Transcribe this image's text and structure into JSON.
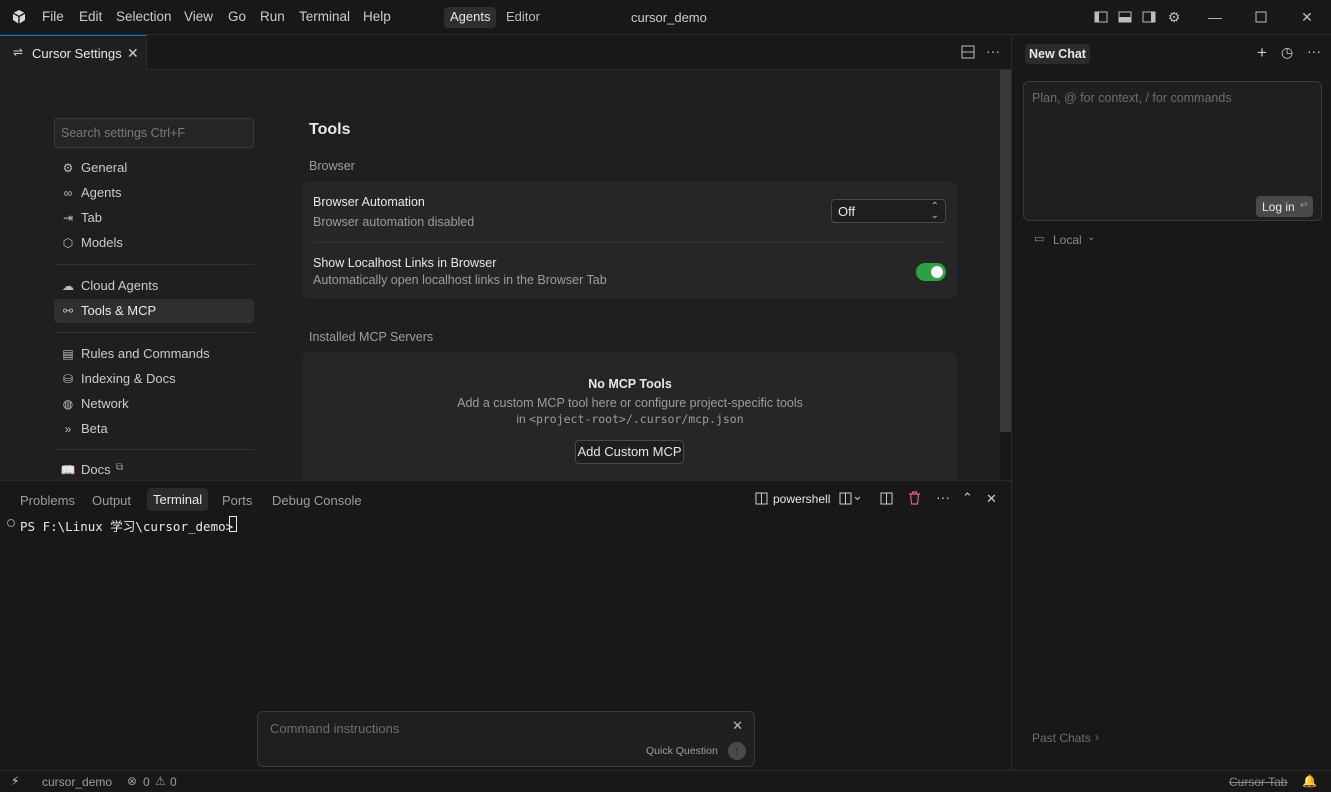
{
  "menu": {
    "file": "File",
    "edit": "Edit",
    "selection": "Selection",
    "view": "View",
    "go": "Go",
    "run": "Run",
    "terminal": "Terminal",
    "help": "Help"
  },
  "modes": {
    "agents": "Agents",
    "editor": "Editor"
  },
  "window_title": "cursor_demo",
  "editor_tab": {
    "label": "Cursor Settings"
  },
  "settings": {
    "search_placeholder": "Search settings Ctrl+F",
    "nav": {
      "general": "General",
      "agents": "Agents",
      "tab": "Tab",
      "models": "Models",
      "cloud_agents": "Cloud Agents",
      "tools_mcp": "Tools & MCP",
      "rules": "Rules and Commands",
      "indexing": "Indexing & Docs",
      "network": "Network",
      "beta": "Beta",
      "docs": "Docs"
    },
    "page_title": "Tools",
    "browser_section": "Browser",
    "browser_automation": {
      "title": "Browser Automation",
      "desc": "Browser automation disabled",
      "value": "Off"
    },
    "localhost_links": {
      "title": "Show Localhost Links in Browser",
      "desc": "Automatically open localhost links in the Browser Tab",
      "enabled": true
    },
    "mcp_section": "Installed MCP Servers",
    "mcp_empty": {
      "title": "No MCP Tools",
      "line1": "Add a custom MCP tool here or configure project-specific tools",
      "line2_prefix": "in ",
      "line2_code": "<project-root>/.cursor/mcp.json",
      "button": "Add Custom MCP"
    }
  },
  "panel": {
    "tabs": {
      "problems": "Problems",
      "output": "Output",
      "terminal": "Terminal",
      "ports": "Ports",
      "debug": "Debug Console"
    },
    "shell": "powershell",
    "prompt": "PS F:\\Linux 学习\\cursor_demo>",
    "cmd_placeholder": "Command instructions",
    "quick_question": "Quick Question"
  },
  "chat": {
    "tab": "New Chat",
    "placeholder": "Plan, @ for context, / for commands",
    "login": "Log in",
    "local": "Local",
    "past_chats": "Past Chats"
  },
  "statusbar": {
    "workspace": "cursor_demo",
    "errors": "0",
    "warnings": "0",
    "cursor_tab": "Cursor Tab"
  }
}
